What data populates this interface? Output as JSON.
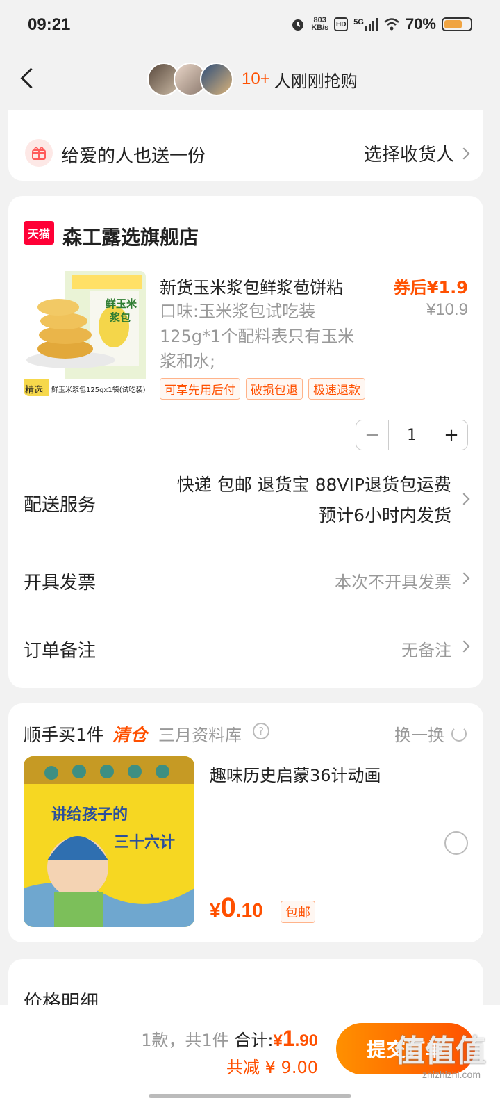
{
  "status_bar": {
    "time": "09:21",
    "net_speed_value": "803",
    "net_speed_unit": "KB/s",
    "hd": "HD",
    "signal": "5G",
    "battery_percent": "70%",
    "battery_level": 0.7
  },
  "header": {
    "buyer_count": "10+",
    "buyer_text": "人刚刚抢购"
  },
  "gift": {
    "label": "给爱的人也送一份",
    "action": "选择收货人"
  },
  "shop": {
    "logo_text": "天猫",
    "name": "森工露选旗舰店"
  },
  "product": {
    "title": "新货玉米浆包鲜浆苞饼粘",
    "desc": "口味:玉米浆包试吃装125g*1个配料表只有玉米浆和水;",
    "price_after_coupon": "券后¥1.9",
    "price_original": "¥10.9",
    "tags": [
      "可享先用后付",
      "破损包退",
      "极速退款"
    ],
    "image_label_1": "鲜玉米",
    "image_label_2": "浆包",
    "image_caption_prefix": "精选",
    "image_caption": "鲜玉米浆包125gx1袋(试吃装)",
    "quantity": "1",
    "minus": "−",
    "plus": "+"
  },
  "delivery": {
    "label": "配送服务",
    "line1": "快递 包邮 退货宝 88VIP退货包运费",
    "line2": "预计6小时内发货"
  },
  "invoice": {
    "label": "开具发票",
    "value": "本次不开具发票"
  },
  "note": {
    "label": "订单备注",
    "value": "无备注"
  },
  "addon": {
    "title": "顺手买1件",
    "clearance": "清仓",
    "shop": "三月资料库",
    "help": "?",
    "refresh": "换一换",
    "item_title": "趣味历史启蒙36计动画",
    "image_text_1": "讲给孩子的",
    "image_text_2": "三十六计",
    "price_yen": "¥",
    "price_int": "0",
    "price_dec": ".10",
    "free_shipping": "包邮"
  },
  "price_detail": {
    "title": "价格明细"
  },
  "bottom": {
    "count_text": "1款，共1件",
    "total_label": "合计:",
    "total_yen": "¥",
    "total_int": "1",
    "total_dec": ".90",
    "discount": "共减 ¥ 9.00",
    "submit": "提交订单",
    "watermark": "值值值",
    "watermark_sub": "zhizhizhi.com"
  },
  "colors": {
    "accent": "#ff5000",
    "tmall": "#ff0036"
  }
}
